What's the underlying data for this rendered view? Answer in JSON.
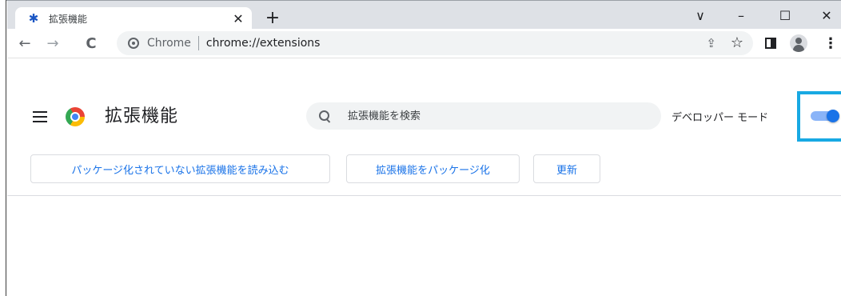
{
  "browser": {
    "tab": {
      "title": "拡張機能",
      "favicon": "puzzle-icon"
    },
    "new_tab_symbol": "+",
    "window_controls": {
      "dropdown": "∨",
      "minimize": "–",
      "maximize": "☐",
      "close": "✕"
    },
    "nav": {
      "back": "←",
      "forward": "→",
      "reload": "C"
    },
    "omnibox": {
      "chip_label": "Chrome",
      "url": "chrome://extensions",
      "share_symbol": "⇪",
      "star_symbol": "☆"
    },
    "kebab_symbol": "⋮"
  },
  "page": {
    "title": "拡張機能",
    "search": {
      "placeholder": "拡張機能を検索"
    },
    "developer_mode": {
      "label": "デベロッパー モード",
      "enabled": true
    }
  },
  "actions": {
    "load_unpacked": "パッケージ化されていない拡張機能を読み込む",
    "pack_extension": "拡張機能をパッケージ化",
    "update": "更新"
  },
  "colors": {
    "accent": "#1a73e8",
    "highlight_box": "#18a9e3"
  }
}
